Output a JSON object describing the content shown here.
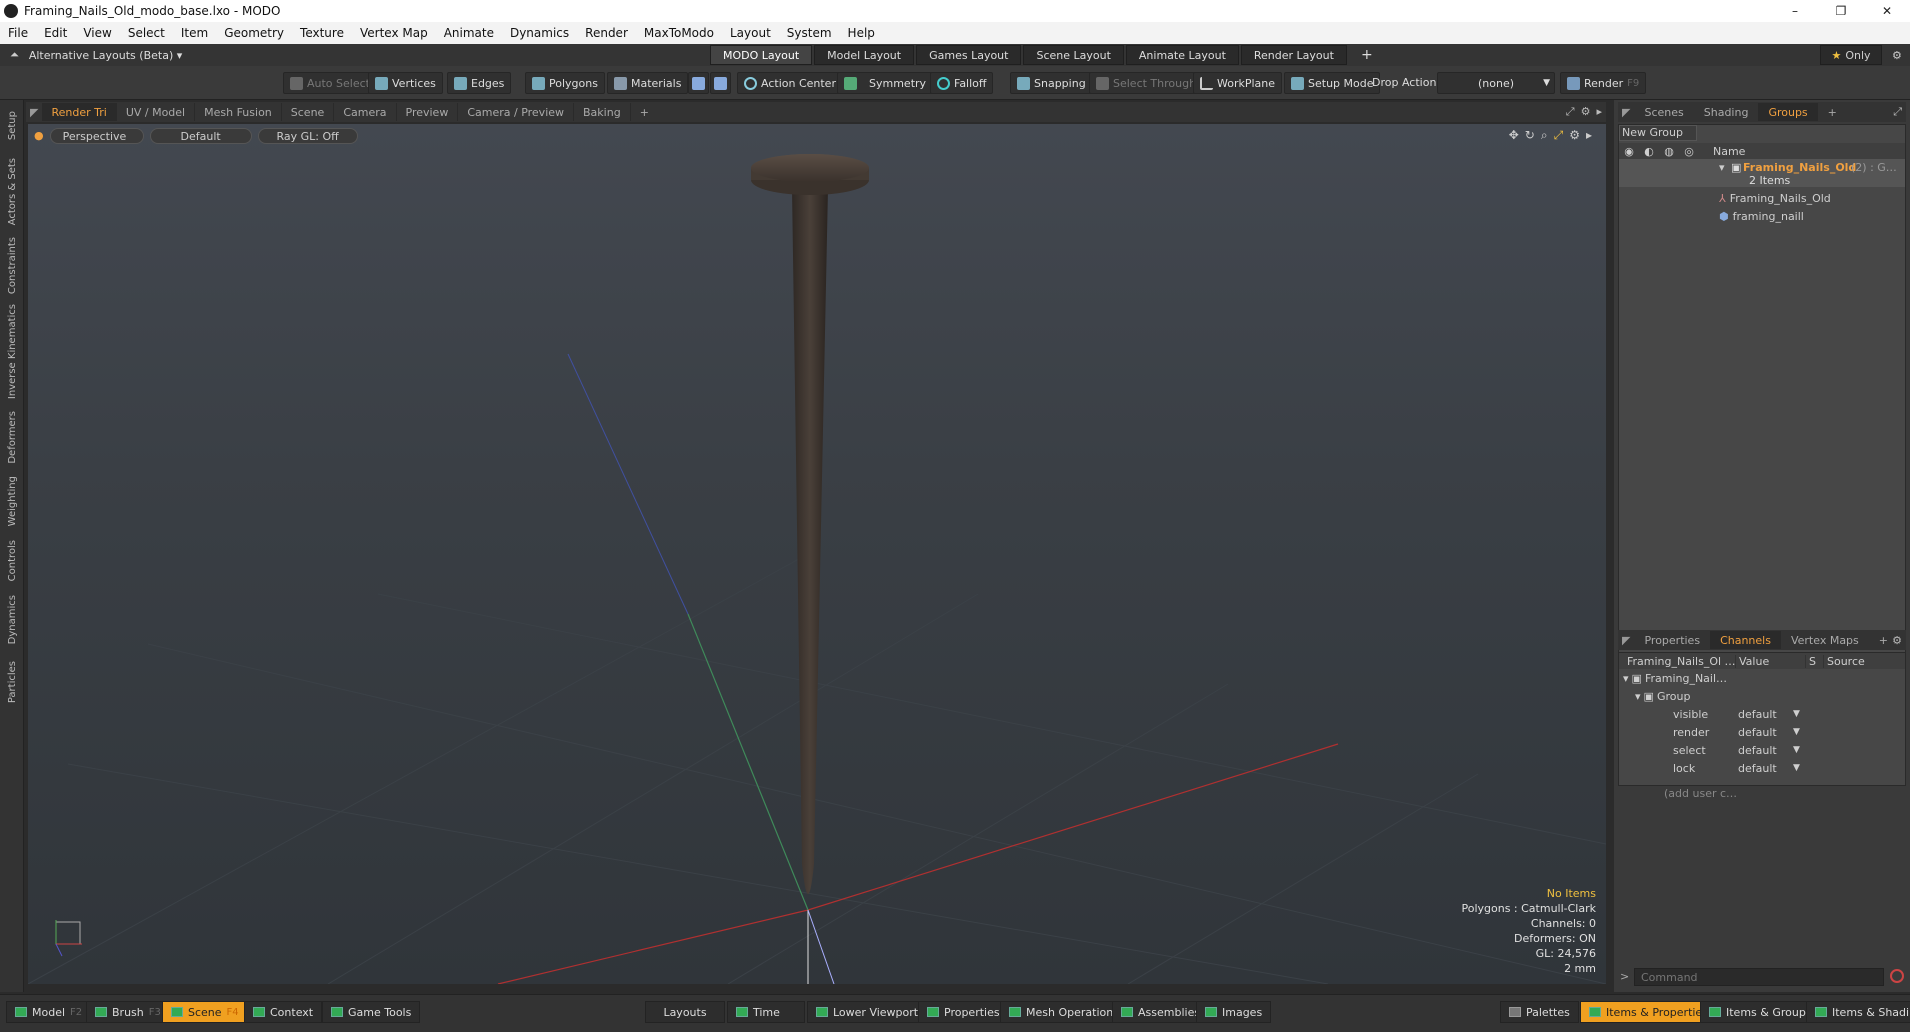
{
  "window": {
    "title": "Framing_Nails_Old_modo_base.lxo - MODO",
    "controls": [
      "–",
      "❐",
      "✕"
    ]
  },
  "menu": [
    "File",
    "Edit",
    "View",
    "Select",
    "Item",
    "Geometry",
    "Texture",
    "Vertex Map",
    "Animate",
    "Dynamics",
    "Render",
    "MaxToModo",
    "Layout",
    "System",
    "Help"
  ],
  "layoutbar": {
    "alt_layouts": "Alternative Layouts (Beta)",
    "tabs": [
      "MODO Layout",
      "Model Layout",
      "Games Layout",
      "Scene Layout",
      "Animate Layout",
      "Render Layout"
    ],
    "active_tab": "MODO Layout",
    "add": "+",
    "only": "Only"
  },
  "toolbar": {
    "auto_select": "Auto Select",
    "vertices": "Vertices",
    "edges": "Edges",
    "polygons": "Polygons",
    "materials": "Materials",
    "action_center": "Action Center",
    "symmetry": "Symmetry",
    "falloff": "Falloff",
    "snapping": "Snapping",
    "select_through": "Select Through",
    "workplane": "WorkPlane",
    "setup_mode": "Setup Mode",
    "drop_action": "Drop Action",
    "drop_value": "(none)",
    "render": "Render",
    "render_key": "F9"
  },
  "left_tabs": [
    "Setup",
    "Actors & Sets",
    "Constraints",
    "Inverse Kinematics",
    "Deformers",
    "Weighting",
    "Controls",
    "Dynamics",
    "Particles"
  ],
  "viewport_tabs": [
    "Render Tri",
    "UV / Model",
    "Mesh Fusion",
    "Scene",
    "Camera",
    "Preview",
    "Camera / Preview",
    "Baking",
    "+"
  ],
  "viewport": {
    "perspective": "Perspective",
    "default": "Default",
    "raygl": "Ray GL: Off",
    "stats": {
      "items": "No Items",
      "polygons": "Polygons : Catmull-Clark",
      "channels": "Channels: 0",
      "deformers": "Deformers: ON",
      "gl": "GL: 24,576",
      "unit": "2 mm"
    }
  },
  "groups_panel": {
    "tabs": [
      "Scenes",
      "Shading",
      "Groups",
      "+"
    ],
    "active": "Groups",
    "new_group": "New Group",
    "name_header": "Name",
    "group_name": "Framing_Nails_Old",
    "group_suffix": "(2) : G…",
    "group_count": "2 Items",
    "children": [
      "Framing_Nails_Old",
      "framing_naill"
    ]
  },
  "channels_panel": {
    "tabs": [
      "Properties",
      "Channels",
      "Vertex Maps",
      "+"
    ],
    "active": "Channels",
    "headers": [
      "Framing_Nails_Ol …",
      "Value",
      "S",
      "Source"
    ],
    "item": "Framing_Nail…",
    "group": "Group",
    "rows": [
      {
        "name": "visible",
        "value": "default"
      },
      {
        "name": "render",
        "value": "default"
      },
      {
        "name": "select",
        "value": "default"
      },
      {
        "name": "lock",
        "value": "default"
      }
    ],
    "add_user": "(add user c…"
  },
  "command": {
    "arrow": ">",
    "placeholder": "Command"
  },
  "bottombar": {
    "left": [
      {
        "label": "Model",
        "key": "F2"
      },
      {
        "label": "Brush",
        "key": "F3"
      },
      {
        "label": "Scene",
        "key": "F4"
      },
      {
        "label": "Context",
        "key": ""
      },
      {
        "label": "Game Tools",
        "key": ""
      }
    ],
    "middle": [
      "Layouts",
      "Time",
      "Lower Viewports",
      "Properties",
      "Mesh Operations",
      "Assemblies",
      "Images"
    ],
    "right": [
      "Palettes",
      "Items & Properties",
      "Items & Groups",
      "Items & Shading"
    ]
  },
  "colors": {
    "accent": "#f0a020",
    "selected_text": "#f0a040"
  }
}
